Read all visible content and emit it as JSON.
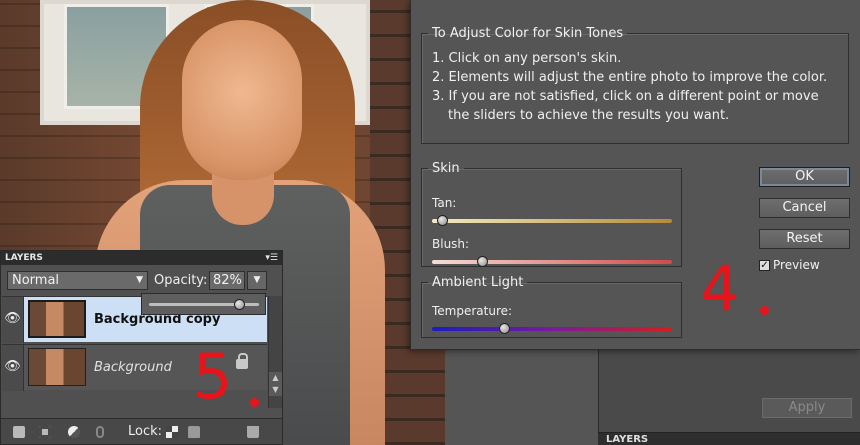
{
  "dialog": {
    "instructions_title": "To Adjust Color for Skin Tones",
    "steps": [
      "1. Click on any person's skin.",
      "2. Elements will adjust the entire photo to improve the color.",
      "3. If you are not satisfied, click on a different point or move",
      "the sliders to achieve the results you want."
    ],
    "skin_group": "Skin",
    "tan_label": "Tan:",
    "tan_value": 0.04,
    "blush_label": "Blush:",
    "blush_value": 0.21,
    "ambient_group": "Ambient Light",
    "temperature_label": "Temperature:",
    "temperature_value": 0.3,
    "ok": "OK",
    "cancel": "Cancel",
    "reset": "Reset",
    "preview": "Preview",
    "preview_checked": true
  },
  "annotations": {
    "four": "4",
    "five": "5",
    "color": "#e8141c"
  },
  "layers": {
    "title": "LAYERS",
    "blend_mode": "Normal",
    "opacity_label": "Opacity:",
    "opacity_value": "82%",
    "items": [
      {
        "name": "Background copy",
        "selected": true
      },
      {
        "name": "Background",
        "selected": false,
        "locked": true
      }
    ],
    "lock_label": "Lock:"
  },
  "right_panel": {
    "apply": "Apply",
    "layers_title": "LAYERS"
  },
  "colors": {
    "dialog_bg": "#555555",
    "selected_row": "#ccdff5",
    "tan_gradient": [
      "#f3ecc0",
      "#b48a3c"
    ],
    "blush_gradient": [
      "#f6dcd6",
      "#d04a4a"
    ],
    "temp_gradient": [
      "#1c1cc0",
      "#d61c1c"
    ]
  }
}
